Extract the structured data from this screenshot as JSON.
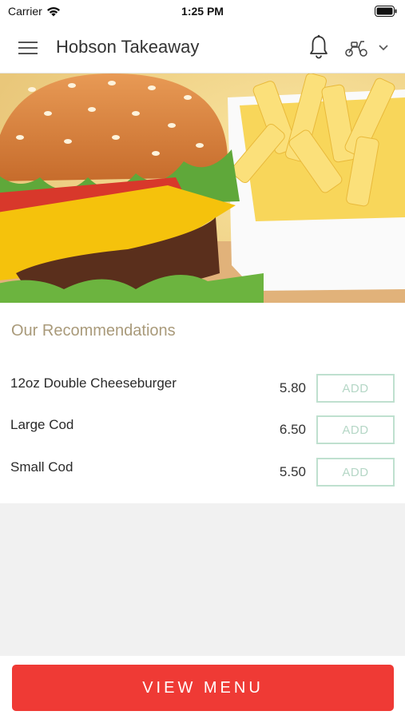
{
  "status_bar": {
    "carrier": "Carrier",
    "time": "1:25 PM"
  },
  "header": {
    "title": "Hobson Takeaway",
    "icons": [
      "menu-icon",
      "bell-icon",
      "scooter-icon",
      "chevron-down-icon"
    ]
  },
  "hero": {
    "image": "burger-and-fries-photo"
  },
  "recommendations": {
    "title": "Our Recommendations",
    "items": [
      {
        "name": "12oz Double Cheeseburger",
        "price": "5.80",
        "add_label": "ADD"
      },
      {
        "name": "Large Cod",
        "price": "6.50",
        "add_label": "ADD"
      },
      {
        "name": "Small Cod",
        "price": "5.50",
        "add_label": "ADD"
      }
    ]
  },
  "footer": {
    "view_menu_label": "VIEW MENU"
  },
  "colors": {
    "accent": "#ef3a35",
    "title_gold": "#a99a7a",
    "add_border": "#bfe0cf",
    "background": "#f1f1f1"
  }
}
